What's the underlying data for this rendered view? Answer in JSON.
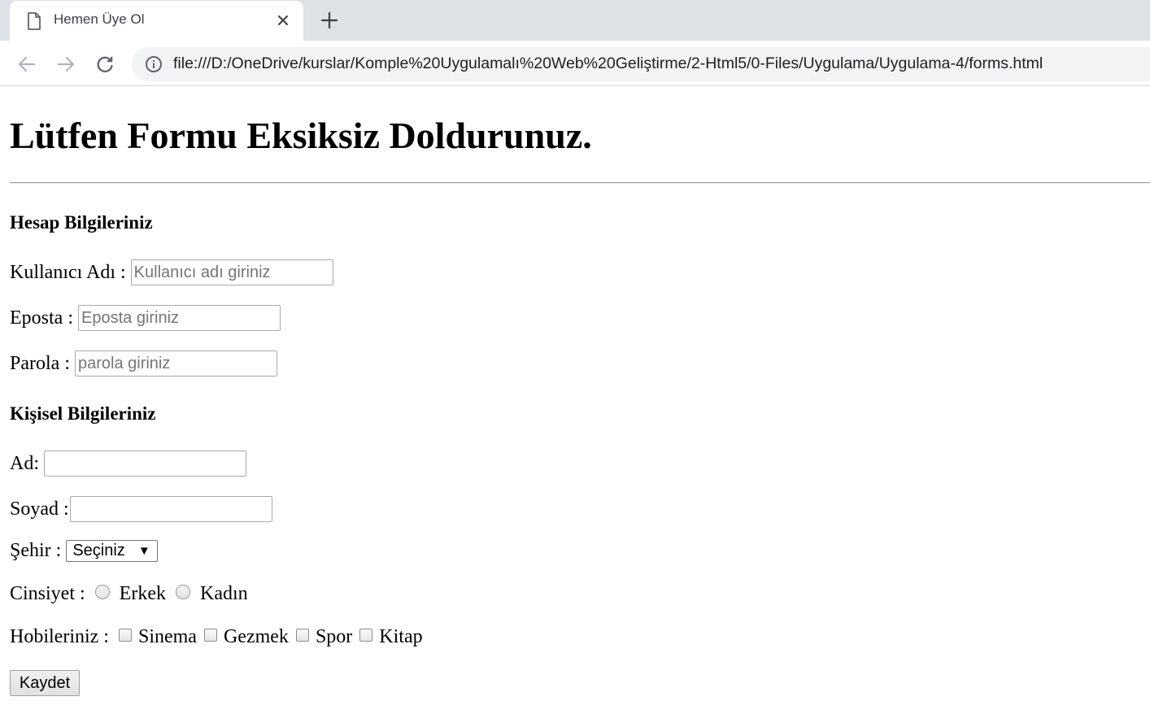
{
  "browser": {
    "tab_title": "Hemen Üye Ol",
    "url": "file:///D:/OneDrive/kurslar/Komple%20Uygulamalı%20Web%20Geliştirme/2-Html5/0-Files/Uygulama/Uygulama-4/forms.html"
  },
  "page": {
    "title": "Lütfen Formu Eksiksiz Doldurunuz.",
    "account_section": {
      "heading": "Hesap Bilgileriniz",
      "username_label": "Kullanıcı Adı :",
      "username_placeholder": "Kullanıcı adı giriniz",
      "email_label": "Eposta :",
      "email_placeholder": "Eposta giriniz",
      "password_label": "Parola :",
      "password_placeholder": "parola giriniz"
    },
    "personal_section": {
      "heading": "Kişisel Bilgileriniz",
      "first_name_label": "Ad:",
      "last_name_label": "Soyad :",
      "city_label": "Şehir :",
      "city_selected": "Seçiniz",
      "gender_label": "Cinsiyet :",
      "gender_options": [
        "Erkek",
        "Kadın"
      ],
      "hobbies_label": "Hobileriniz :",
      "hobby_options": [
        "Sinema",
        "Gezmek",
        "Spor",
        "Kitap"
      ]
    },
    "save_label": "Kaydet"
  }
}
